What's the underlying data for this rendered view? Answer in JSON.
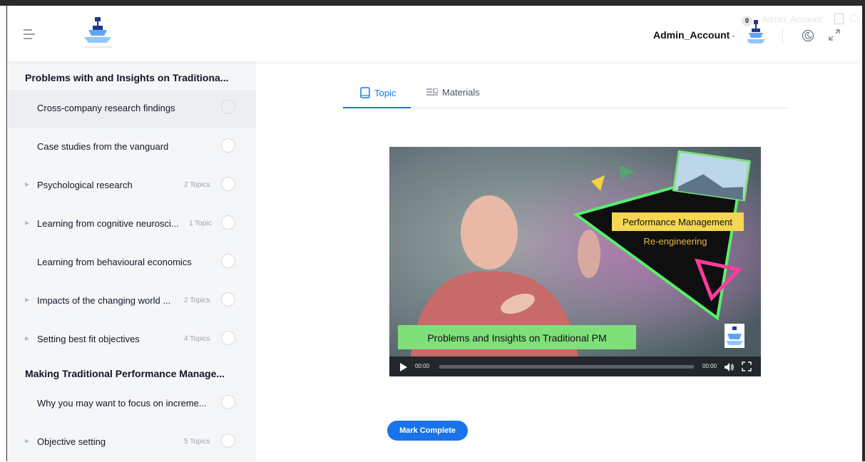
{
  "header": {
    "user_name": "Admin_Account",
    "faint_user_name": "Admin_Account",
    "notification_count": "0",
    "icons": [
      "hamburger-menu-icon",
      "logo",
      "chevron-down-icon",
      "moon-icon",
      "expand-icon"
    ]
  },
  "sidebar": {
    "sections": [
      {
        "title": "Problems with and Insights on Traditiona...",
        "items": [
          {
            "label": "Cross-company research findings",
            "count": "",
            "expandable": false,
            "active": true
          },
          {
            "label": "Case studies from the vanguard",
            "count": "",
            "expandable": false,
            "active": false
          },
          {
            "label": "Psychological research",
            "count": "2 Topics",
            "expandable": true,
            "active": false
          },
          {
            "label": "Learning from cognitive neurosci...",
            "count": "1 Topic",
            "expandable": true,
            "active": false
          },
          {
            "label": "Learning from behavioural economics",
            "count": "",
            "expandable": false,
            "active": false
          },
          {
            "label": "Impacts of the changing world ...",
            "count": "2 Topics",
            "expandable": true,
            "active": false
          },
          {
            "label": "Setting best fit objectives",
            "count": "4 Topics",
            "expandable": true,
            "active": false
          }
        ]
      },
      {
        "title": "Making Traditional Performance Manage...",
        "items": [
          {
            "label": "Why you may want to focus on increme...",
            "count": "",
            "expandable": false,
            "active": false
          },
          {
            "label": "Objective setting",
            "count": "5 Topics",
            "expandable": true,
            "active": false
          }
        ]
      }
    ]
  },
  "tabs": [
    {
      "label": "Topic",
      "icon": "book-icon",
      "active": true
    },
    {
      "label": "Materials",
      "icon": "list-icon",
      "active": false
    }
  ],
  "video": {
    "title_banner": "Performance Management",
    "subtitle": "Re-engineering",
    "caption": "Problems and Insights on Traditional PM",
    "current_time": "00:00",
    "duration": "00:00",
    "progress": 0
  },
  "actions": {
    "mark_complete": "Mark Complete"
  },
  "colors": {
    "accent": "#1a73e8",
    "sidebar_bg": "#f5f6f8",
    "banner_yellow": "#f6d652",
    "caption_green": "#7fe07a",
    "neon_green": "#56f06b",
    "neon_pink": "#ff3ca0"
  }
}
